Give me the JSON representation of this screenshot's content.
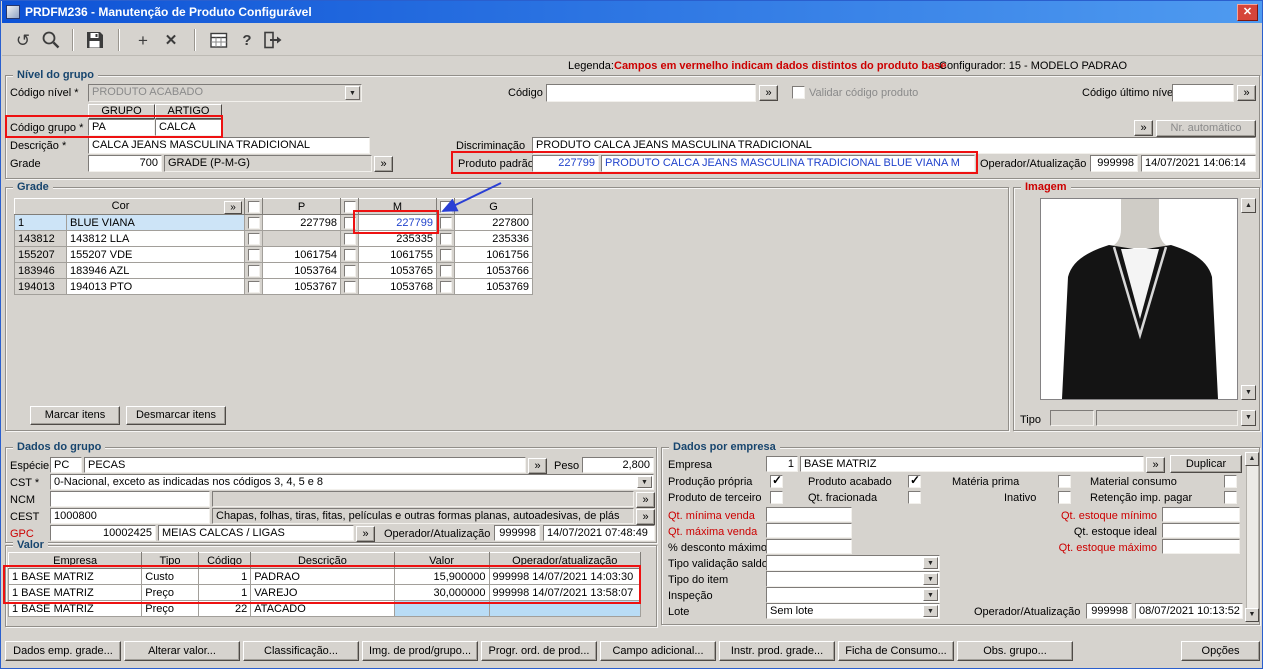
{
  "window": {
    "title": "PRDFM236 - Manutenção de Produto Configurável"
  },
  "ui": {
    "lookup": "»",
    "dd": "▼",
    "up": "▲",
    "down": "▼",
    "undo": "↺",
    "add": "+",
    "delete": "✕",
    "help": "?"
  },
  "toolbar": {
    "icon_names": [
      "undo-icon",
      "search-icon",
      "save-icon",
      "add-icon",
      "delete-icon",
      "calendar-icon",
      "help-icon",
      "exit-icon"
    ]
  },
  "legend": {
    "label": "Legenda:",
    "message": "Campos em vermelho indicam dados distintos do produto base",
    "configurador": "Configurador: 15 - MODELO PADRAO"
  },
  "nivel": {
    "legend": "Nível do grupo",
    "codigo_nivel_label": "Código nível *",
    "codigo_nivel_value": "PRODUTO ACABADO",
    "codigo_label": "Código",
    "validar_label": "Validar código produto",
    "codigo_ultimo_label": "Código último nível",
    "grupo_header": "GRUPO",
    "artigo_header": "ARTIGO",
    "codigo_grupo_label": "Código grupo *",
    "grupo_value": "PA",
    "artigo_value": "CALCA",
    "nr_automatico_label": "Nr. automático",
    "descricao_label": "Descrição *",
    "descricao_value": "CALCA JEANS MASCULINA TRADICIONAL",
    "discriminacao_label": "Discriminação",
    "discriminacao_value": "PRODUTO CALCA JEANS MASCULINA TRADICIONAL",
    "grade_label": "Grade",
    "grade_num": "700",
    "grade_nome": "GRADE (P-M-G)",
    "produto_padrao_label": "Produto padrão",
    "produto_padrao_codigo": "227799",
    "produto_padrao_descricao": "PRODUTO CALCA JEANS MASCULINA TRADICIONAL BLUE VIANA M",
    "operador_label": "Operador/Atualização",
    "operador_value": "999998",
    "atualizacao_value": "14/07/2021 14:06:14"
  },
  "grade": {
    "legend": "Grade",
    "headers": {
      "cor": "Cor",
      "p": "P",
      "m": "M",
      "g": "G"
    },
    "rows": [
      {
        "id": "1",
        "cor": "BLUE VIANA",
        "p": "227798",
        "m": "227799",
        "g": "227800"
      },
      {
        "id": "143812",
        "cor": "143812 LLA",
        "p": "",
        "m": "235335",
        "g": "235336"
      },
      {
        "id": "155207",
        "cor": "155207 VDE",
        "p": "1061754",
        "m": "1061755",
        "g": "1061756"
      },
      {
        "id": "183946",
        "cor": "183946 AZL",
        "p": "1053764",
        "m": "1053765",
        "g": "1053766"
      },
      {
        "id": "194013",
        "cor": "194013 PTO",
        "p": "1053767",
        "m": "1053768",
        "g": "1053769"
      }
    ],
    "marcar_label": "Marcar itens",
    "desmarcar_label": "Desmarcar itens"
  },
  "imagem": {
    "legend": "Imagem",
    "tipo_label": "Tipo"
  },
  "dados_grupo": {
    "legend": "Dados do grupo",
    "especie_label": "Espécie *",
    "especie_cod": "PC",
    "especie_nome": "PECAS",
    "peso_label": "Peso",
    "peso_value": "2,800",
    "cst_label": "CST *",
    "cst_value": "0-Nacional, exceto as indicadas nos códigos 3, 4, 5 e 8",
    "ncm_label": "NCM",
    "cest_label": "CEST",
    "cest_cod": "1000800",
    "cest_desc": "Chapas, folhas, tiras, fitas, películas e outras formas planas, autoadesivas, de plás",
    "gpc_label": "GPC",
    "gpc_cod": "10002425",
    "gpc_desc": "MEIAS CALCAS / LIGAS",
    "operador_label": "Operador/Atualização",
    "operador_value": "999998",
    "atualizacao_value": "14/07/2021 07:48:49"
  },
  "valor": {
    "legend": "Valor",
    "headers": [
      "Empresa",
      "Tipo",
      "Código",
      "Descrição",
      "Valor",
      "Operador/atualização"
    ],
    "rows": [
      [
        "1 BASE MATRIZ",
        "Custo",
        "1",
        "PADRAO",
        "15,900000",
        "999998 14/07/2021 14:03:30"
      ],
      [
        "1 BASE MATRIZ",
        "Preço",
        "1",
        "VAREJO",
        "30,000000",
        "999998 14/07/2021 13:58:07"
      ],
      [
        "1 BASE MATRIZ",
        "Preço",
        "22",
        "ATACADO",
        "",
        ""
      ]
    ]
  },
  "dados_empresa": {
    "legend": "Dados por empresa",
    "empresa_label": "Empresa",
    "empresa_cod": "1",
    "empresa_nome": "BASE MATRIZ",
    "duplicar_label": "Duplicar",
    "chk_producao": "Produção própria",
    "chk_acabado": "Produto acabado",
    "chk_materia": "Matéria prima",
    "chk_material": "Material consumo",
    "chk_terceiro": "Produto de terceiro",
    "chk_fracionada": "Qt. fracionada",
    "chk_inativo": "Inativo",
    "chk_retencao": "Retenção imp. pagar",
    "qt_min_venda": "Qt. mínima venda",
    "qt_max_venda": "Qt. máxima venda",
    "desc_max": "% desconto máximo",
    "qt_est_min": "Qt. estoque mínimo",
    "qt_est_ideal": "Qt. estoque ideal",
    "qt_est_max": "Qt. estoque máximo",
    "tipo_validacao_label": "Tipo validação saldo",
    "tipo_item_label": "Tipo do item",
    "inspecao_label": "Inspeção",
    "lote_label": "Lote",
    "lote_value": "Sem lote",
    "operador_label": "Operador/Atualização",
    "operador_value": "999998",
    "atualizacao_value": "08/07/2021 10:13:52"
  },
  "checks": {
    "validar_codigo": false,
    "producao_propria": true,
    "produto_acabado": true,
    "materia_prima": false,
    "material_consumo": false,
    "produto_terceiro": false,
    "qt_fracionada": false,
    "inativo": false,
    "retencao_imp_pagar": false
  },
  "footer": {
    "buttons": [
      "Dados emp. grade...",
      "Alterar valor...",
      "Classificação...",
      "Img. de prod/grupo...",
      "Progr. ord. de prod...",
      "Campo adicional...",
      "Instr. prod. grade...",
      "Ficha de Consumo...",
      "Obs. grupo...",
      "Opções"
    ]
  },
  "colors": {
    "annotation_red": "#ee1111",
    "link_blue": "#2244cc",
    "alert_red": "#cc0000",
    "highlight_blue": "#cde4f7",
    "titlebar_blue": "#0d52d6"
  }
}
